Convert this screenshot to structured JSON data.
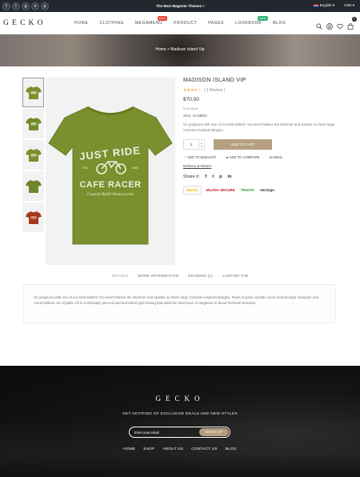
{
  "topbar": {
    "social": [
      "f",
      "t",
      "g",
      "o",
      "p"
    ],
    "promo": "The Best Magento Themes !",
    "language": "English",
    "currency": "USD"
  },
  "header": {
    "logo": "GECKO",
    "nav": [
      {
        "label": "HOME"
      },
      {
        "label": "CLOTHING"
      },
      {
        "label": "MEGAMENU",
        "badge": "HOT",
        "badge_color": "#e84c3d"
      },
      {
        "label": "PRODUCT"
      },
      {
        "label": "PAGES"
      },
      {
        "label": "LOOKBOOK",
        "badge": "NEW",
        "badge_color": "#35b27a"
      },
      {
        "label": "BLOG"
      }
    ],
    "cart_count": "0"
  },
  "breadcrumb": "Home  >  Madison Island Vip",
  "product": {
    "shirt_color": "#7a8f2e",
    "shirt_text": [
      "JUST RIDE",
      "EST",
      "1987",
      "CAFE RACER",
      "Custom Build Motorcycles"
    ],
    "title": "MADISON ISLAND VIP",
    "rating": 4,
    "stars": "★★★★☆",
    "reviews": "( 1 Review )",
    "price": "$70.00",
    "stock": "In stock",
    "sku": "SKU: 24-MB32",
    "description": "Go gorgeous with one of our best-sellers! You won't believe the shimmer and sparkle on these large Victorian-inspired dangles.",
    "qty": "1",
    "add_to_cart": "ADD TO CART",
    "wishlist": "ADD TO WISHLIST",
    "compare": "ADD TO COMPARE",
    "email": "EMAIL",
    "delivery": "Delivery & Return",
    "share_label": "Share it:",
    "share_icons": [
      "f",
      "t",
      "p",
      "in"
    ],
    "trust": [
      {
        "label": "Norton",
        "color": "#f0b400"
      },
      {
        "label": "McAfee SECURE",
        "color": "#c8102e"
      },
      {
        "label": "TRUSTe",
        "color": "#2a9a2a"
      },
      {
        "label": "VeriSign",
        "color": "#333333"
      }
    ]
  },
  "tabs": {
    "items": [
      "DETAILS",
      "MORE INFORMATION",
      "REVIEWS (1)",
      "CUSTOM TAB"
    ],
    "active": "DETAILS",
    "content": "Go gorgeous with one of our best-sellers! You won't believe the shimmer and sparkle on these large Victorian-inspired dangles. Rows of pave crystals curve around large marquise and round brilliant cut crystals. All in a delicately pierced and burnished gold setting that adds the final touch of elegance to these heirloom beauties."
  },
  "footer": {
    "logo": "GECKO",
    "subtitle": "GET NOTIFIED OF EXCLUSIVE DEALS AND NEW STYLES",
    "email_placeholder": "Enter your email",
    "signup": "SIGN UP",
    "nav": [
      "HOME",
      "SHOP",
      "ABOUT US",
      "CONTACT US",
      "BLOG"
    ]
  }
}
